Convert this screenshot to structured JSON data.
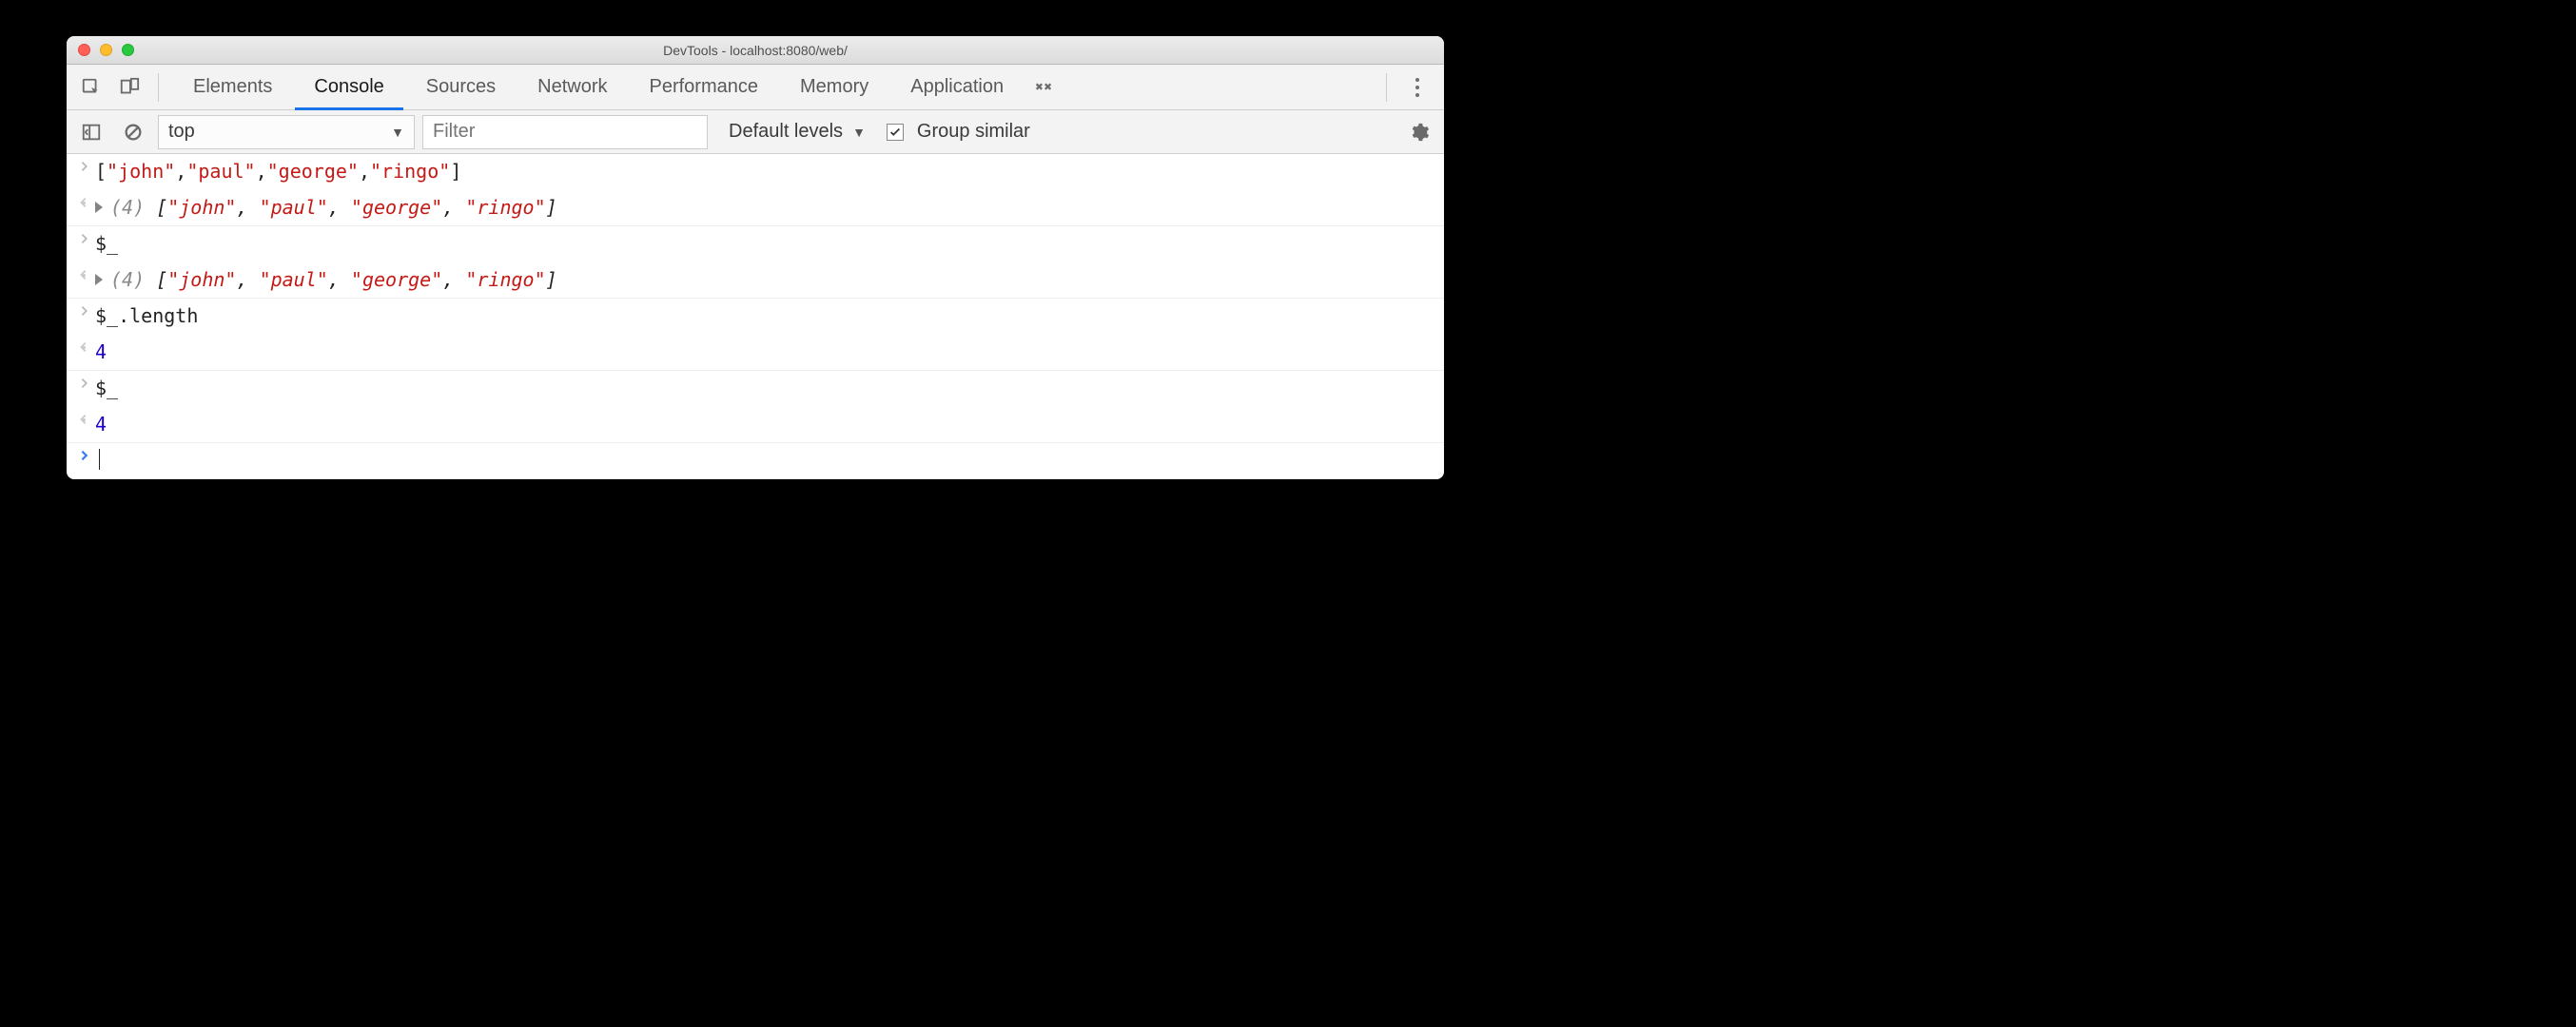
{
  "window": {
    "title": "DevTools - localhost:8080/web/"
  },
  "tabbar": {
    "tabs": [
      {
        "label": "Elements",
        "active": false
      },
      {
        "label": "Console",
        "active": true
      },
      {
        "label": "Sources",
        "active": false
      },
      {
        "label": "Network",
        "active": false
      },
      {
        "label": "Performance",
        "active": false
      },
      {
        "label": "Memory",
        "active": false
      },
      {
        "label": "Application",
        "active": false
      }
    ]
  },
  "subbar": {
    "context": "top",
    "filter_placeholder": "Filter",
    "levels_label": "Default levels",
    "group_similar_label": "Group similar",
    "group_similar_checked": true
  },
  "console": {
    "rows": [
      {
        "kind": "input",
        "segments": [
          {
            "t": "punct",
            "v": "["
          },
          {
            "t": "str",
            "v": "\"john\""
          },
          {
            "t": "punct",
            "v": ","
          },
          {
            "t": "str",
            "v": "\"paul\""
          },
          {
            "t": "punct",
            "v": ","
          },
          {
            "t": "str",
            "v": "\"george\""
          },
          {
            "t": "punct",
            "v": ","
          },
          {
            "t": "str",
            "v": "\"ringo\""
          },
          {
            "t": "punct",
            "v": "]"
          }
        ],
        "grouped_with_next": true
      },
      {
        "kind": "output",
        "expandable": true,
        "prefix_gray": "(4) ",
        "segments": [
          {
            "t": "punct",
            "v": "["
          },
          {
            "t": "str",
            "v": "\"john\""
          },
          {
            "t": "punct",
            "v": ", "
          },
          {
            "t": "str",
            "v": "\"paul\""
          },
          {
            "t": "punct",
            "v": ", "
          },
          {
            "t": "str",
            "v": "\"george\""
          },
          {
            "t": "punct",
            "v": ", "
          },
          {
            "t": "str",
            "v": "\"ringo\""
          },
          {
            "t": "punct",
            "v": "]"
          }
        ],
        "italic": true
      },
      {
        "kind": "input",
        "segments": [
          {
            "t": "punct",
            "v": "$_"
          }
        ],
        "grouped_with_next": true
      },
      {
        "kind": "output",
        "expandable": true,
        "prefix_gray": "(4) ",
        "segments": [
          {
            "t": "punct",
            "v": "["
          },
          {
            "t": "str",
            "v": "\"john\""
          },
          {
            "t": "punct",
            "v": ", "
          },
          {
            "t": "str",
            "v": "\"paul\""
          },
          {
            "t": "punct",
            "v": ", "
          },
          {
            "t": "str",
            "v": "\"george\""
          },
          {
            "t": "punct",
            "v": ", "
          },
          {
            "t": "str",
            "v": "\"ringo\""
          },
          {
            "t": "punct",
            "v": "]"
          }
        ],
        "italic": true
      },
      {
        "kind": "input",
        "segments": [
          {
            "t": "punct",
            "v": "$_.length"
          }
        ],
        "grouped_with_next": true
      },
      {
        "kind": "output",
        "segments": [
          {
            "t": "num",
            "v": "4"
          }
        ]
      },
      {
        "kind": "input",
        "segments": [
          {
            "t": "punct",
            "v": "$_"
          }
        ],
        "grouped_with_next": true
      },
      {
        "kind": "output",
        "segments": [
          {
            "t": "num",
            "v": "4"
          }
        ]
      },
      {
        "kind": "prompt"
      }
    ]
  }
}
